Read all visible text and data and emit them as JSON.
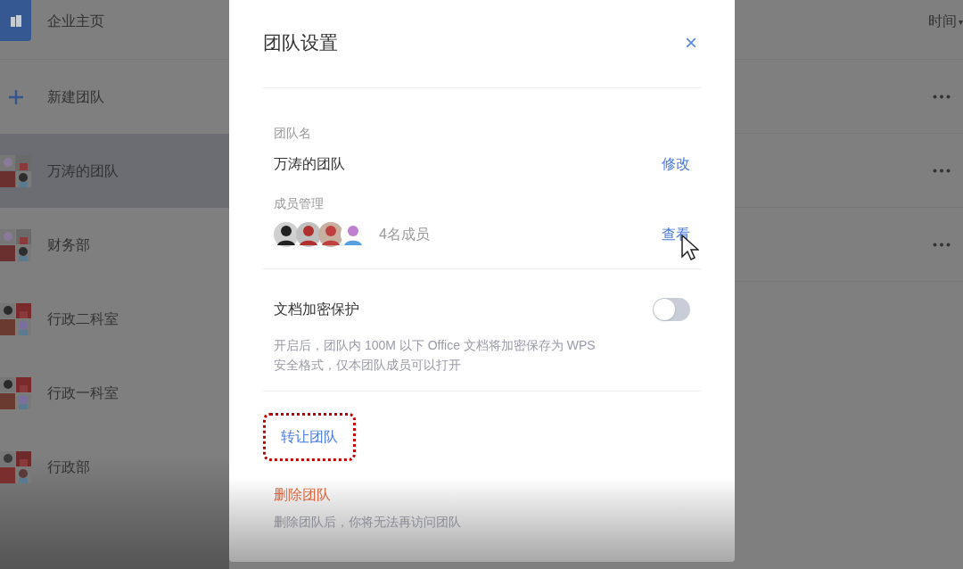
{
  "sidebar": {
    "items": [
      {
        "kind": "home",
        "label": "企业主页",
        "selected": false
      },
      {
        "kind": "add",
        "label": "新建团队",
        "selected": false
      },
      {
        "kind": "team",
        "label": "万涛的团队",
        "selected": true
      },
      {
        "kind": "team",
        "label": "财务部",
        "selected": false
      },
      {
        "kind": "team",
        "label": "行政二科室",
        "selected": false
      },
      {
        "kind": "team",
        "label": "行政一科室",
        "selected": false
      },
      {
        "kind": "team",
        "label": "行政部",
        "selected": false
      }
    ]
  },
  "list": {
    "sort": {
      "label": "时间",
      "caret": "▾"
    },
    "rows": [
      {
        "kind": "row"
      },
      {
        "kind": "row"
      },
      {
        "kind": "row"
      }
    ]
  },
  "dialog": {
    "title": "团队设置",
    "close": "×",
    "name_section": {
      "label": "团队名",
      "value": "万涛的团队",
      "action": "修改"
    },
    "members_section": {
      "label": "成员管理",
      "count": "4名成员",
      "action": "查看"
    },
    "encryption": {
      "label": "文档加密保护",
      "on": false,
      "description": "开启后，团队内 100M 以下 Office 文档将加密保存为 WPS 安全格式，仅本团队成员可以打开"
    },
    "transfer": {
      "label": "转让团队",
      "annotated": true
    },
    "delete": {
      "label": "删除团队",
      "description": "删除团队后，你将无法再访问团队"
    }
  }
}
